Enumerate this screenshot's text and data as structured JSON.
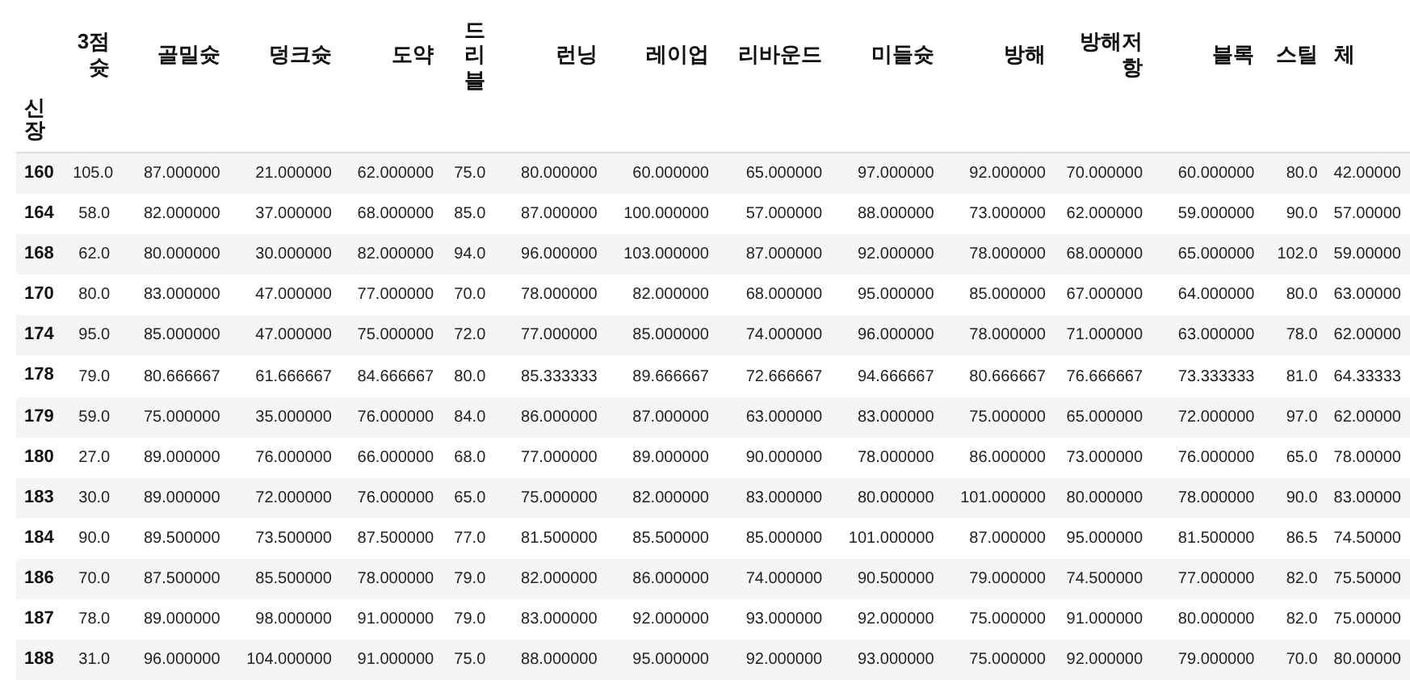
{
  "table": {
    "index_name": "신장",
    "columns": [
      "3점슛",
      "골밀슛",
      "덩크슛",
      "도약",
      "드리블",
      "런닝",
      "레이업",
      "리바운드",
      "미들슛",
      "방해",
      "방해저항",
      "블록",
      "스틸",
      "체"
    ],
    "rows": [
      {
        "index": "160",
        "values": [
          "105.0",
          "87.000000",
          "21.000000",
          "62.000000",
          "75.0",
          "80.000000",
          "60.000000",
          "65.000000",
          "97.000000",
          "92.000000",
          "70.000000",
          "60.000000",
          "80.0",
          "42.00000"
        ]
      },
      {
        "index": "164",
        "values": [
          "58.0",
          "82.000000",
          "37.000000",
          "68.000000",
          "85.0",
          "87.000000",
          "100.000000",
          "57.000000",
          "88.000000",
          "73.000000",
          "62.000000",
          "59.000000",
          "90.0",
          "57.00000"
        ]
      },
      {
        "index": "168",
        "values": [
          "62.0",
          "80.000000",
          "30.000000",
          "82.000000",
          "94.0",
          "96.000000",
          "103.000000",
          "87.000000",
          "92.000000",
          "78.000000",
          "68.000000",
          "65.000000",
          "102.0",
          "59.00000"
        ]
      },
      {
        "index": "170",
        "values": [
          "80.0",
          "83.000000",
          "47.000000",
          "77.000000",
          "70.0",
          "78.000000",
          "82.000000",
          "68.000000",
          "95.000000",
          "85.000000",
          "67.000000",
          "64.000000",
          "80.0",
          "63.00000"
        ]
      },
      {
        "index": "174",
        "values": [
          "95.0",
          "85.000000",
          "47.000000",
          "75.000000",
          "72.0",
          "77.000000",
          "85.000000",
          "74.000000",
          "96.000000",
          "78.000000",
          "71.000000",
          "63.000000",
          "78.0",
          "62.00000"
        ]
      },
      {
        "index": "178",
        "values": [
          "79.0",
          "80.666667",
          "61.666667",
          "84.666667",
          "80.0",
          "85.333333",
          "89.666667",
          "72.666667",
          "94.666667",
          "80.666667",
          "76.666667",
          "73.333333",
          "81.0",
          "64.33333"
        ]
      },
      {
        "index": "179",
        "values": [
          "59.0",
          "75.000000",
          "35.000000",
          "76.000000",
          "84.0",
          "86.000000",
          "87.000000",
          "63.000000",
          "83.000000",
          "75.000000",
          "65.000000",
          "72.000000",
          "97.0",
          "62.00000"
        ]
      },
      {
        "index": "180",
        "values": [
          "27.0",
          "89.000000",
          "76.000000",
          "66.000000",
          "68.0",
          "77.000000",
          "89.000000",
          "90.000000",
          "78.000000",
          "86.000000",
          "73.000000",
          "76.000000",
          "65.0",
          "78.00000"
        ]
      },
      {
        "index": "183",
        "values": [
          "30.0",
          "89.000000",
          "72.000000",
          "76.000000",
          "65.0",
          "75.000000",
          "82.000000",
          "83.000000",
          "80.000000",
          "101.000000",
          "80.000000",
          "78.000000",
          "90.0",
          "83.00000"
        ]
      },
      {
        "index": "184",
        "values": [
          "90.0",
          "89.500000",
          "73.500000",
          "87.500000",
          "77.0",
          "81.500000",
          "85.500000",
          "85.000000",
          "101.000000",
          "87.000000",
          "95.000000",
          "81.500000",
          "86.5",
          "74.50000"
        ]
      },
      {
        "index": "186",
        "values": [
          "70.0",
          "87.500000",
          "85.500000",
          "78.000000",
          "79.0",
          "82.000000",
          "86.000000",
          "74.000000",
          "90.500000",
          "79.000000",
          "74.500000",
          "77.000000",
          "82.0",
          "75.50000"
        ]
      },
      {
        "index": "187",
        "values": [
          "78.0",
          "89.000000",
          "98.000000",
          "91.000000",
          "79.0",
          "83.000000",
          "92.000000",
          "93.000000",
          "92.000000",
          "75.000000",
          "91.000000",
          "80.000000",
          "82.0",
          "75.00000"
        ]
      },
      {
        "index": "188",
        "values": [
          "31.0",
          "96.000000",
          "104.000000",
          "91.000000",
          "75.0",
          "88.000000",
          "95.000000",
          "92.000000",
          "93.000000",
          "75.000000",
          "92.000000",
          "79.000000",
          "70.0",
          "80.00000"
        ]
      }
    ]
  }
}
